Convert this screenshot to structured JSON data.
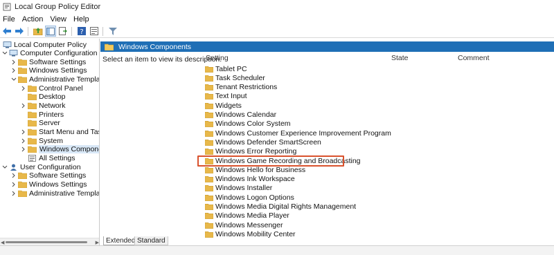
{
  "window": {
    "title": "Local Group Policy Editor",
    "icon": "gpedit-icon"
  },
  "menu": [
    "File",
    "Action",
    "View",
    "Help"
  ],
  "toolbar": {
    "buttons": [
      {
        "name": "back-icon"
      },
      {
        "name": "forward-icon"
      },
      {
        "name": "up-folder-icon"
      },
      {
        "name": "show-hide-tree-icon"
      },
      {
        "name": "export-list-icon"
      },
      {
        "name": "help-icon"
      },
      {
        "name": "properties-icon"
      },
      {
        "name": "filter-icon"
      }
    ]
  },
  "tree": {
    "root": "Local Computer Policy",
    "items": [
      {
        "label": "Local Computer Policy",
        "level": 0,
        "icon": "computer-policy-icon",
        "expander": "none"
      },
      {
        "label": "Computer Configuration",
        "level": 1,
        "icon": "computer-icon",
        "expander": "expanded"
      },
      {
        "label": "Software Settings",
        "level": 2,
        "icon": "folder-icon",
        "expander": "collapsed"
      },
      {
        "label": "Windows Settings",
        "level": 2,
        "icon": "folder-icon",
        "expander": "collapsed"
      },
      {
        "label": "Administrative Templates",
        "level": 2,
        "icon": "folder-icon",
        "expander": "expanded"
      },
      {
        "label": "Control Panel",
        "level": 3,
        "icon": "folder-icon",
        "expander": "collapsed"
      },
      {
        "label": "Desktop",
        "level": 3,
        "icon": "folder-icon",
        "expander": "none"
      },
      {
        "label": "Network",
        "level": 3,
        "icon": "folder-icon",
        "expander": "collapsed"
      },
      {
        "label": "Printers",
        "level": 3,
        "icon": "folder-icon",
        "expander": "none"
      },
      {
        "label": "Server",
        "level": 3,
        "icon": "folder-icon",
        "expander": "none"
      },
      {
        "label": "Start Menu and Taskbar",
        "level": 3,
        "icon": "folder-icon",
        "expander": "collapsed"
      },
      {
        "label": "System",
        "level": 3,
        "icon": "folder-icon",
        "expander": "collapsed"
      },
      {
        "label": "Windows Components",
        "level": 3,
        "icon": "folder-icon",
        "expander": "collapsed",
        "selected": true
      },
      {
        "label": "All Settings",
        "level": 3,
        "icon": "settings-list-icon",
        "expander": "none"
      },
      {
        "label": "User Configuration",
        "level": 1,
        "icon": "user-icon",
        "expander": "expanded"
      },
      {
        "label": "Software Settings",
        "level": 2,
        "icon": "folder-icon",
        "expander": "collapsed"
      },
      {
        "label": "Windows Settings",
        "level": 2,
        "icon": "folder-icon",
        "expander": "collapsed"
      },
      {
        "label": "Administrative Templates",
        "level": 2,
        "icon": "folder-icon",
        "expander": "collapsed"
      }
    ]
  },
  "details": {
    "header": "Windows Components",
    "description": "Select an item to view its description.",
    "columns": [
      "Setting",
      "State",
      "Comment"
    ],
    "items": [
      "Tablet PC",
      "Task Scheduler",
      "Tenant Restrictions",
      "Text Input",
      "Widgets",
      "Windows Calendar",
      "Windows Color System",
      "Windows Customer Experience Improvement Program",
      "Windows Defender SmartScreen",
      "Windows Error Reporting",
      "Windows Game Recording and Broadcasting",
      "Windows Hello for Business",
      "Windows Ink Workspace",
      "Windows Installer",
      "Windows Logon Options",
      "Windows Media Digital Rights Management",
      "Windows Media Player",
      "Windows Messenger",
      "Windows Mobility Center"
    ],
    "highlighted_item": "Windows Game Recording and Broadcasting"
  },
  "tabs": [
    {
      "label": "Extended",
      "active": true
    },
    {
      "label": "Standard",
      "active": false
    }
  ],
  "colors": {
    "header_bg": "#1f6fb6",
    "folder": "#e8b84a",
    "highlight_border": "#d9512c",
    "selection": "#d9e8f7"
  }
}
